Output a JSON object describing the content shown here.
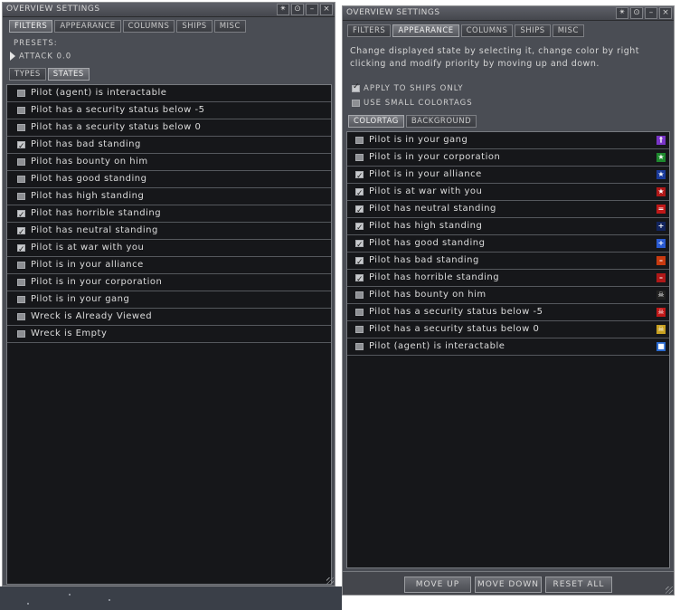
{
  "left_window": {
    "title": "OVERVIEW SETTINGS",
    "title_buttons": [
      "✴",
      "⊙",
      "–",
      "×"
    ],
    "tabs": [
      {
        "label": "FILTERS",
        "active": true
      },
      {
        "label": "APPEARANCE",
        "active": false
      },
      {
        "label": "COLUMNS",
        "active": false
      },
      {
        "label": "SHIPS",
        "active": false
      },
      {
        "label": "MISC",
        "active": false
      }
    ],
    "presets_label": "PRESETS:",
    "preset_value": "ATTACK 0.0",
    "subtabs": [
      {
        "label": "TYPES",
        "active": false
      },
      {
        "label": "STATES",
        "active": true
      }
    ],
    "states": [
      {
        "label": "Pilot (agent) is interactable",
        "checked": false
      },
      {
        "label": "Pilot has a security status below -5",
        "checked": false
      },
      {
        "label": "Pilot has a security status below 0",
        "checked": false
      },
      {
        "label": "Pilot has bad standing",
        "checked": true
      },
      {
        "label": "Pilot has bounty on him",
        "checked": false
      },
      {
        "label": "Pilot has good standing",
        "checked": false
      },
      {
        "label": "Pilot has high standing",
        "checked": false
      },
      {
        "label": "Pilot has horrible standing",
        "checked": true
      },
      {
        "label": "Pilot has neutral standing",
        "checked": true
      },
      {
        "label": "Pilot is at war with you",
        "checked": true
      },
      {
        "label": "Pilot is in your alliance",
        "checked": false
      },
      {
        "label": "Pilot is in your corporation",
        "checked": false
      },
      {
        "label": "Pilot is in your gang",
        "checked": false
      },
      {
        "label": "Wreck is Already Viewed",
        "checked": false
      },
      {
        "label": "Wreck is Empty",
        "checked": false
      }
    ]
  },
  "right_window": {
    "title": "OVERVIEW SETTINGS",
    "title_buttons": [
      "✴",
      "⊙",
      "–",
      "×"
    ],
    "tabs": [
      {
        "label": "FILTERS",
        "active": false
      },
      {
        "label": "APPEARANCE",
        "active": true
      },
      {
        "label": "COLUMNS",
        "active": false
      },
      {
        "label": "SHIPS",
        "active": false
      },
      {
        "label": "MISC",
        "active": false
      }
    ],
    "description": "Change displayed state by selecting it, change color by right clicking and modify priority by moving up and down.",
    "options": [
      {
        "label": "APPLY TO SHIPS ONLY",
        "checked": true
      },
      {
        "label": "USE SMALL COLORTAGS",
        "checked": false
      }
    ],
    "subtabs": [
      {
        "label": "COLORTAG",
        "active": true
      },
      {
        "label": "BACKGROUND",
        "active": false
      }
    ],
    "colortags": [
      {
        "label": "Pilot is in your gang",
        "checked": false,
        "icon": "gang-icon",
        "glyph": "†",
        "color": "#7a35c8"
      },
      {
        "label": "Pilot is in your corporation",
        "checked": false,
        "icon": "corporation-star-icon",
        "glyph": "★",
        "color": "#1e8a2e"
      },
      {
        "label": "Pilot is in your alliance",
        "checked": true,
        "icon": "alliance-star-icon",
        "glyph": "★",
        "color": "#1a3a9a"
      },
      {
        "label": "Pilot is at war with you",
        "checked": true,
        "icon": "war-star-icon",
        "glyph": "★",
        "color": "#b01818"
      },
      {
        "label": "Pilot has neutral standing",
        "checked": true,
        "icon": "neutral-icon",
        "glyph": "=",
        "color": "#c01818"
      },
      {
        "label": "Pilot has high standing",
        "checked": true,
        "icon": "high-standing-icon",
        "glyph": "+",
        "color": "#12245e"
      },
      {
        "label": "Pilot has good standing",
        "checked": true,
        "icon": "good-standing-icon",
        "glyph": "+",
        "color": "#2a5ad0"
      },
      {
        "label": "Pilot has bad standing",
        "checked": true,
        "icon": "bad-standing-icon",
        "glyph": "–",
        "color": "#c83a10"
      },
      {
        "label": "Pilot has horrible standing",
        "checked": true,
        "icon": "horrible-standing-icon",
        "glyph": "–",
        "color": "#b01818"
      },
      {
        "label": "Pilot has bounty on him",
        "checked": false,
        "icon": "bounty-skull-icon",
        "glyph": "☠",
        "color": "#222222"
      },
      {
        "label": "Pilot has a security status below -5",
        "checked": false,
        "icon": "security-skull-red-icon",
        "glyph": "☠",
        "color": "#c01818"
      },
      {
        "label": "Pilot has a security status below 0",
        "checked": false,
        "icon": "security-skull-yellow-icon",
        "glyph": "☠",
        "color": "#c8a020"
      },
      {
        "label": "Pilot (agent) is interactable",
        "checked": false,
        "icon": "agent-chat-icon",
        "glyph": "■",
        "color": "#2a6ad0"
      }
    ],
    "buttons": {
      "move_up": "MOVE UP",
      "move_down": "MOVE DOWN",
      "reset_all": "RESET ALL"
    }
  }
}
